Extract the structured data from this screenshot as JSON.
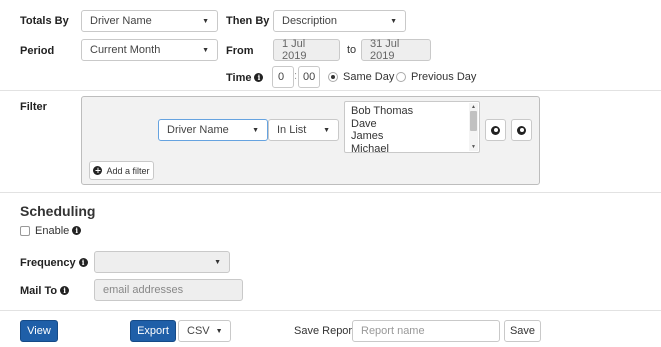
{
  "report": {
    "totals_by_label": "Totals By",
    "totals_by_value": "Driver Name",
    "then_by_label": "Then By",
    "then_by_value": "Description",
    "period_label": "Period",
    "period_value": "Current Month",
    "from_label": "From",
    "from_value": "1 Jul 2019",
    "to_label": "to",
    "to_value": "31 Jul 2019",
    "time_label": "Time",
    "time_hour": "0",
    "time_minute": "00",
    "same_day_label": "Same Day",
    "previous_day_label": "Previous Day",
    "same_day_checked": true
  },
  "filter": {
    "label": "Filter",
    "field_value": "Driver Name",
    "operator_value": "In List",
    "list_items": [
      "Bob Thomas",
      "Dave",
      "James",
      "Michael"
    ],
    "add_filter_label": "Add a filter"
  },
  "scheduling": {
    "heading": "Scheduling",
    "enable_label": "Enable",
    "frequency_label": "Frequency",
    "frequency_value": "",
    "mail_to_label": "Mail To",
    "mail_to_placeholder": "email addresses"
  },
  "actions": {
    "view_label": "View",
    "export_label": "Export",
    "format_value": "CSV",
    "save_report_label": "Save Report",
    "report_name_placeholder": "Report name",
    "save_label": "Save"
  },
  "colors": {
    "primary": "#1f5fa8",
    "border": "#c9c9c9",
    "disabled_bg": "#eeeeee",
    "filter_panel_bg": "#f2f2f2"
  }
}
